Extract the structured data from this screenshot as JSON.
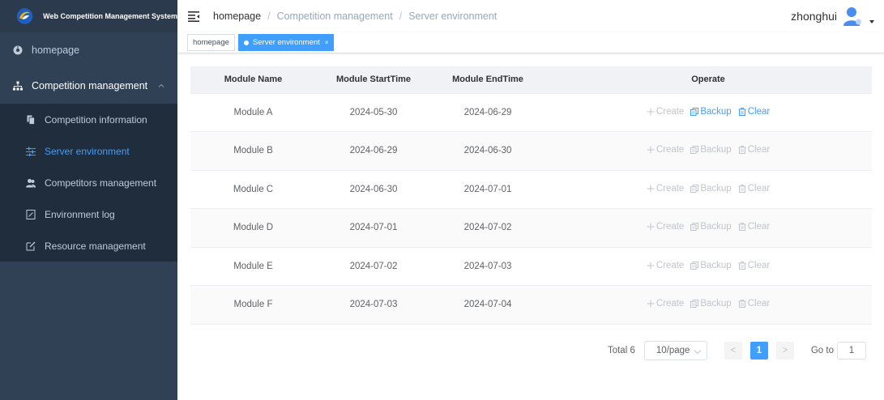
{
  "app": {
    "title": "Web Competition Management System"
  },
  "sidebar": {
    "homepage": {
      "label": "homepage",
      "icon": "dashboard-icon"
    },
    "group": {
      "label": "Competition management",
      "icon": "tree-icon",
      "expanded": true
    },
    "items": [
      {
        "label": "Competition information",
        "icon": "document-icon",
        "active": false
      },
      {
        "label": "Server environment",
        "icon": "sliders-icon",
        "active": true
      },
      {
        "label": "Competitors management",
        "icon": "users-icon",
        "active": false
      },
      {
        "label": "Environment log",
        "icon": "log-icon",
        "active": false
      },
      {
        "label": "Resource management",
        "icon": "edit-icon",
        "active": false
      }
    ]
  },
  "header": {
    "breadcrumb": [
      "homepage",
      "Competition management",
      "Server environment"
    ],
    "username": "zhonghui"
  },
  "tags": [
    {
      "label": "homepage",
      "active": false
    },
    {
      "label": "Server environment",
      "active": true,
      "close": "×"
    }
  ],
  "table": {
    "columns": [
      "Module Name",
      "Module StartTime",
      "Module EndTime",
      "Operate"
    ],
    "rows": [
      {
        "name": "Module A",
        "start": "2024-05-30",
        "end": "2024-06-29",
        "ops_enabled": [
          false,
          true,
          true
        ]
      },
      {
        "name": "Module B",
        "start": "2024-06-29",
        "end": "2024-06-30",
        "ops_enabled": [
          false,
          false,
          false
        ]
      },
      {
        "name": "Module C",
        "start": "2024-06-30",
        "end": "2024-07-01",
        "ops_enabled": [
          false,
          false,
          false
        ]
      },
      {
        "name": "Module D",
        "start": "2024-07-01",
        "end": "2024-07-02",
        "ops_enabled": [
          false,
          false,
          false
        ]
      },
      {
        "name": "Module E",
        "start": "2024-07-02",
        "end": "2024-07-03",
        "ops_enabled": [
          false,
          false,
          false
        ]
      },
      {
        "name": "Module F",
        "start": "2024-07-03",
        "end": "2024-07-04",
        "ops_enabled": [
          false,
          false,
          false
        ]
      }
    ],
    "ops": [
      "Create",
      "Backup",
      "Clear"
    ]
  },
  "pagination": {
    "total": "Total 6",
    "page_size": "10/page",
    "prev": "<",
    "current": "1",
    "next": ">",
    "goto_label": "Go to",
    "goto_value": "1"
  },
  "colors": {
    "sidebar_bg": "#304156",
    "accent": "#409eff"
  }
}
